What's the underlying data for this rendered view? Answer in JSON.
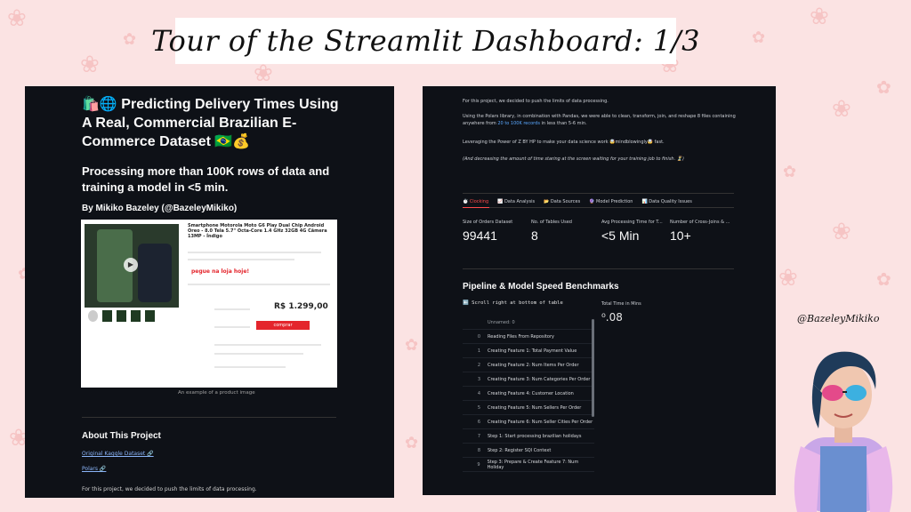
{
  "slide": {
    "title": "Tour of the Streamlit Dashboard:  1/3",
    "handle": "@BazeleyMikiko"
  },
  "left_panel": {
    "heading": "🛍️🌐 Predicting Delivery Times Using A Real, Commercial Brazilian E-Commerce Dataset 🇧🇷💰",
    "subheading": "Processing more than 100K rows of data and training a model in <5 min.",
    "byline": "By Mikiko Bazeley (@BazeleyMikiko)",
    "product": {
      "title": "Smartphone Motorola Moto G6 Play Dual Chip Android Oreo - 8.0 Tela 5.7\" Octa-Core 1.4 GHz 32GB 4G Câmera 13MP - Índigo",
      "price": "R$ 1.299,00",
      "promo": "pegue na loja hoje!",
      "buy_label": "comprar"
    },
    "image_caption": "An example of a product image",
    "about_title": "About This Project",
    "links": [
      "Original Kaggle Dataset 🔗",
      "Polars 🔗"
    ],
    "footer_text": "For this project, we decided to push the limits of data processing."
  },
  "right_panel": {
    "intro_1": "For this project, we decided to push the limits of data processing.",
    "intro_2_a": "Using the Polars library, in combination with Pandas, we were able to clean, transform, join, and reshape 8 files containing anywhere from ",
    "intro_2_hl": "20 to 100K records",
    "intro_2_b": " in less than 5-6 min.",
    "intro_3": "Leveraging the Power of Z BY HP to make your data science work 🤯mindblowingly🤯 fast.",
    "intro_4": "(And decreasing the amount of time staring at the screen waiting for your training job to finish. ⏳)",
    "tabs": [
      "⏱️ Clocking",
      "📈 Data Analysis",
      "📂 Data Sources",
      "🔮 Model Prediction",
      "📊 Data Quality Issues"
    ],
    "metrics": [
      {
        "label": "Size of Orders Dataset",
        "value": "99441"
      },
      {
        "label": "No. of Tables Used",
        "value": "8"
      },
      {
        "label": "Avg Processing Time for T...",
        "value": "<5 Min"
      },
      {
        "label": "Number of Cross-Joins & ...",
        "value": "10+"
      }
    ],
    "bench_title": "Pipeline & Model Speed Benchmarks",
    "scroll_note": "⬅️ Scroll right at bottom of table",
    "total_label": "Total Time in Mins",
    "total_value": "⁰.08",
    "table_header": "Unnamed: 0",
    "table_rows": [
      {
        "idx": "0",
        "text": "Reading Files From Repository"
      },
      {
        "idx": "1",
        "text": "Creating Feature 1: Total Payment Value"
      },
      {
        "idx": "2",
        "text": "Creating Feature 2: Num Items Per Order"
      },
      {
        "idx": "3",
        "text": "Creating Feature 3: Num Categories Per Order"
      },
      {
        "idx": "4",
        "text": "Creating Feature 4: Customer Location"
      },
      {
        "idx": "5",
        "text": "Creating Feature 5: Num Sellers Per Order"
      },
      {
        "idx": "6",
        "text": "Creating Feature 6: Num Seller Cities Per Order"
      },
      {
        "idx": "7",
        "text": "Step 1: Start processing brazilian holidays"
      },
      {
        "idx": "8",
        "text": "Step 2: Register SQl Context"
      },
      {
        "idx": "9",
        "text": "Step 3: Prepare & Create Feature 7: Num Holiday"
      }
    ]
  }
}
